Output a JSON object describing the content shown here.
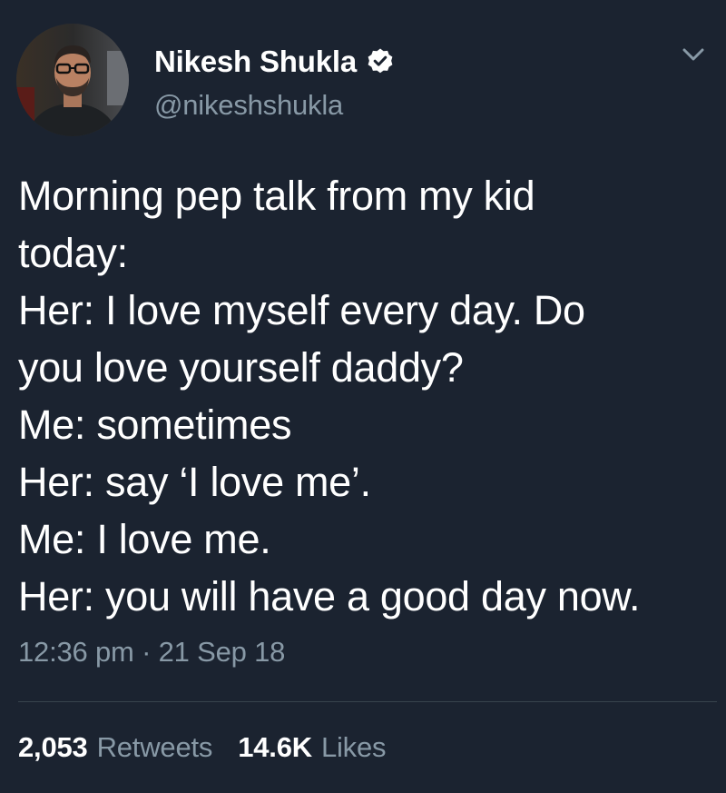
{
  "author": {
    "display_name": "Nikesh Shukla",
    "handle": "@nikeshshukla",
    "verified": true
  },
  "tweet": {
    "lines": [
      "Morning pep talk from my kid",
      "today:",
      "Her: I love myself every day. Do",
      "you love yourself daddy?",
      "Me: sometimes",
      "Her: say ‘I love me’.",
      "Me: I love me.",
      "Her: you will have a good day now."
    ],
    "timestamp": "12:36 pm · 21 Sep 18"
  },
  "stats": {
    "retweets_count": "2,053",
    "retweets_label": "Retweets",
    "likes_count": "14.6K",
    "likes_label": "Likes"
  },
  "icons": {
    "verified": "verified-badge-icon",
    "menu": "chevron-down-icon"
  },
  "colors": {
    "background": "#1b2330",
    "text": "#ffffff",
    "secondary": "#8899a6",
    "divider": "#38444d"
  }
}
